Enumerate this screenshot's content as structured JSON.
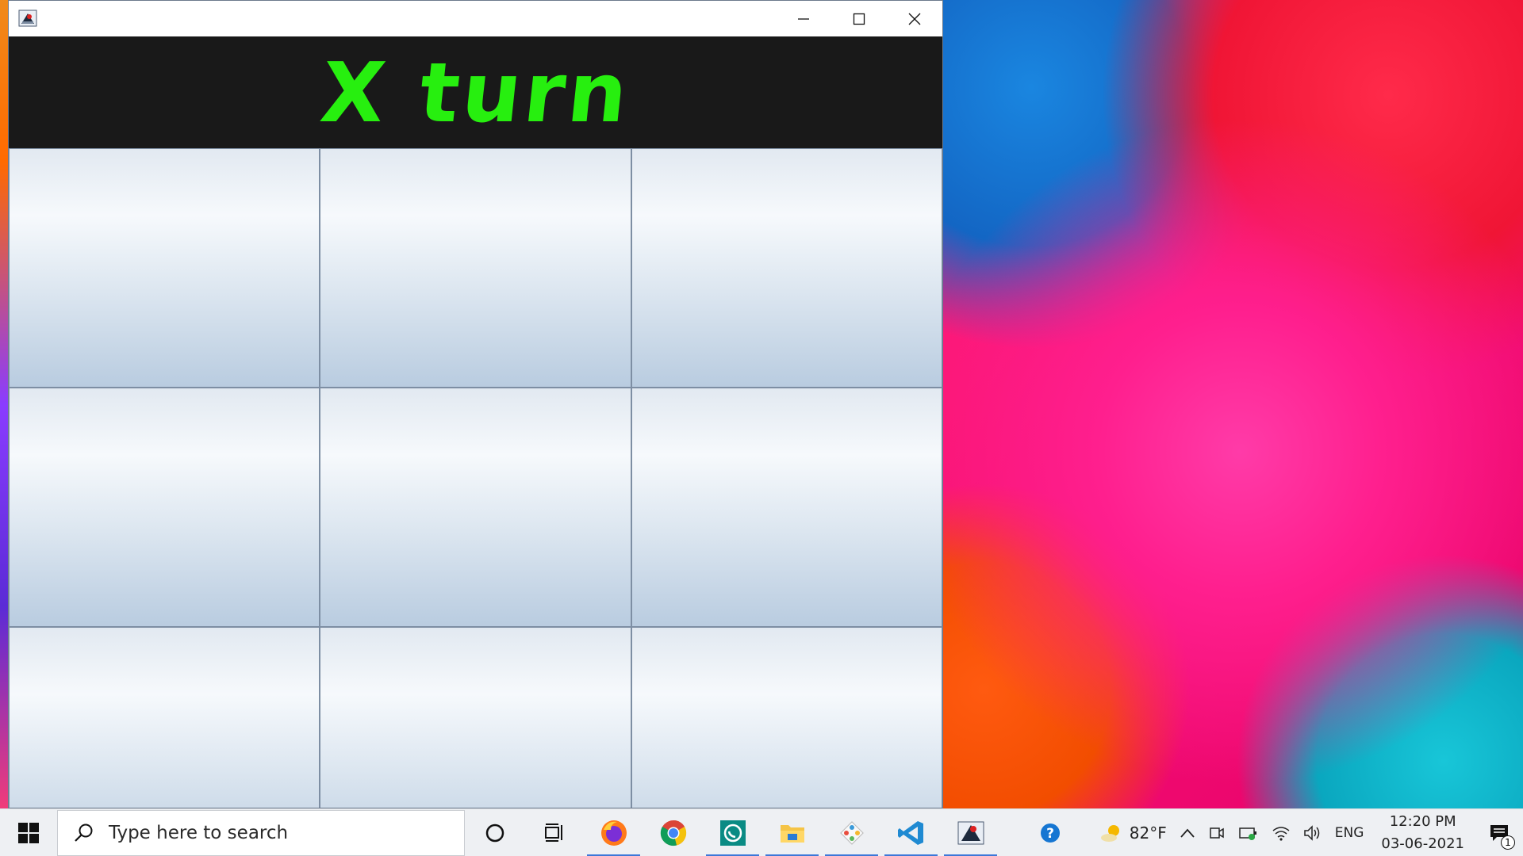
{
  "window": {
    "game_status": "X turn",
    "controls": [
      "minimize",
      "maximize",
      "close"
    ],
    "board": {
      "rows": 3,
      "cols": 3,
      "cells": [
        "",
        "",
        "",
        "",
        "",
        "",
        "",
        "",
        ""
      ]
    },
    "colors": {
      "status_text": "#27ef0f",
      "header_bg": "#191919"
    }
  },
  "taskbar": {
    "search_placeholder": "Type here to search",
    "pinned_apps": [
      {
        "name": "cortana",
        "icon": "circle-icon"
      },
      {
        "name": "task-view",
        "icon": "task-view-icon"
      },
      {
        "name": "firefox",
        "icon": "firefox-icon"
      },
      {
        "name": "chrome",
        "icon": "chrome-icon"
      },
      {
        "name": "whatsapp",
        "icon": "whatsapp-icon"
      },
      {
        "name": "file-explorer",
        "icon": "folder-icon"
      },
      {
        "name": "git",
        "icon": "git-icon"
      },
      {
        "name": "vscode",
        "icon": "vscode-icon"
      },
      {
        "name": "java-app",
        "icon": "java-icon"
      }
    ],
    "tray": {
      "weather_temp": "82°F",
      "language": "ENG",
      "time": "12:20 PM",
      "date": "03-06-2021",
      "notification_count": "1"
    }
  }
}
